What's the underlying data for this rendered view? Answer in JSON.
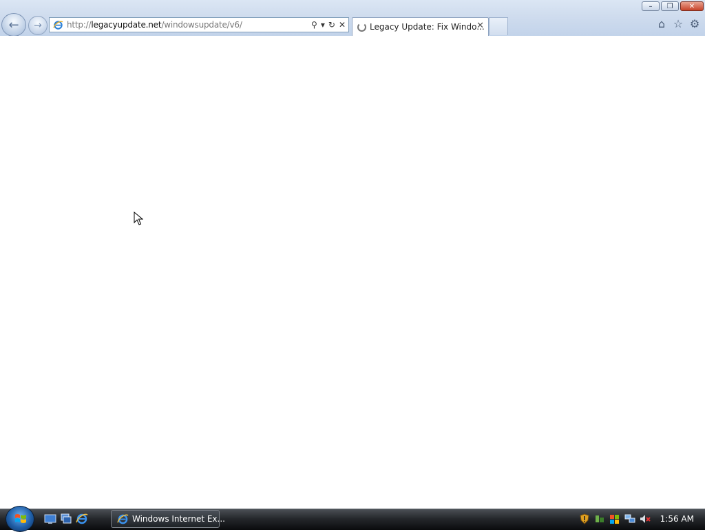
{
  "window": {
    "controls": [
      "minimize",
      "restore",
      "close"
    ]
  },
  "navigation": {
    "back_icon": "back-arrow-icon",
    "forward_icon": "forward-arrow-icon"
  },
  "address_bar": {
    "url_scheme": "http://",
    "url_host": "legacyupdate.net",
    "url_path": "/windowsupdate/v6/"
  },
  "tabs": [
    {
      "title": "Legacy Update: Fix Windo...",
      "loading": true
    }
  ],
  "command_bar": {
    "icons": [
      "home-icon",
      "favorites-star-icon",
      "tools-gear-icon"
    ]
  },
  "taskbar": {
    "active_window": "Windows Internet Ex...",
    "clock": "1:56 AM"
  },
  "colors": {
    "chrome": "#cfdcee",
    "taskbar": "#1e2226",
    "tab_background": "#ffffff"
  }
}
